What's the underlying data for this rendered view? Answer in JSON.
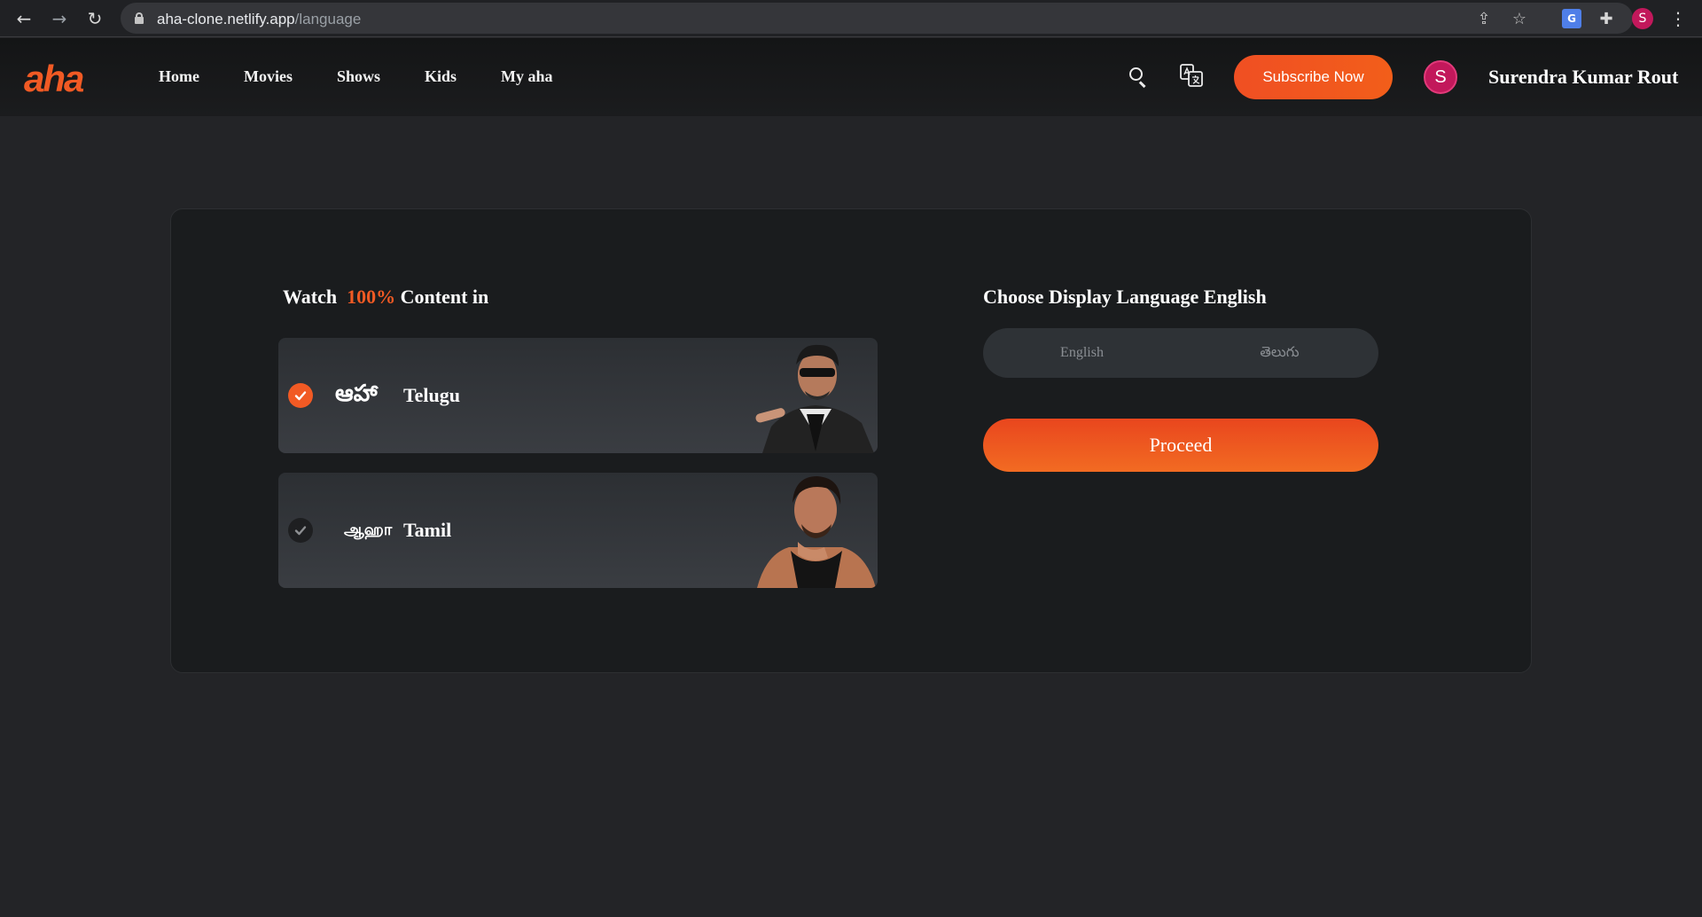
{
  "browser": {
    "url_host": "aha-clone.netlify.app",
    "url_path": "/language",
    "profile_initial": "S"
  },
  "header": {
    "logo": "aha",
    "nav": [
      {
        "label": "Home"
      },
      {
        "label": "Movies"
      },
      {
        "label": "Shows"
      },
      {
        "label": "Kids"
      },
      {
        "label": "My aha"
      }
    ],
    "subscribe_label": "Subscribe Now",
    "avatar_initial": "S",
    "user_name": "Surendra Kumar Rout"
  },
  "content_section": {
    "title_prefix": "Watch",
    "title_accent": "100%",
    "title_suffix": "Content in",
    "options": [
      {
        "logo_text": "ఆహా",
        "label": "Telugu",
        "selected": true
      },
      {
        "logo_text": "ஆஹா",
        "label": "Tamil",
        "selected": false
      }
    ]
  },
  "display_section": {
    "title": "Choose Display Language English",
    "toggle_options": [
      {
        "label": "English"
      },
      {
        "label": "తెలుగు"
      }
    ],
    "proceed_label": "Proceed"
  },
  "colors": {
    "accent": "#f15a24",
    "background": "#232427",
    "card": "#1a1c1e"
  }
}
